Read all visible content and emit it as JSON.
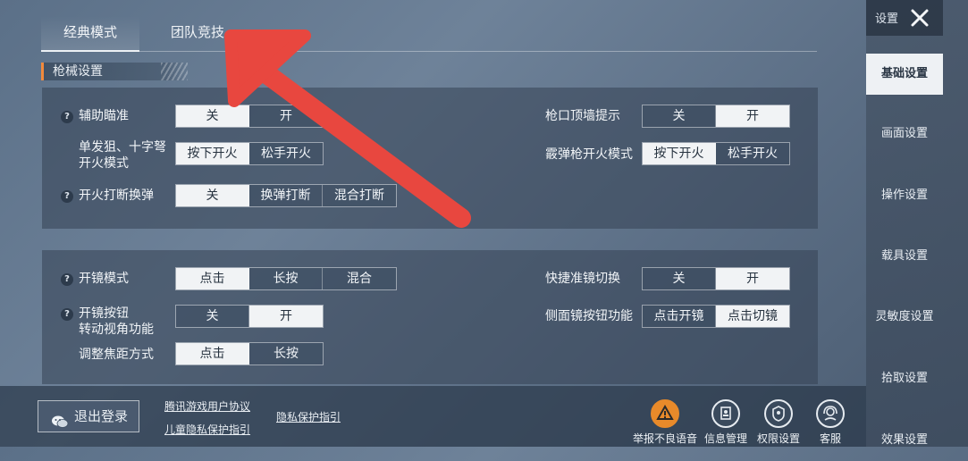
{
  "tabs": [
    "经典模式",
    "团队竞技"
  ],
  "section_title": "枪械设置",
  "panel1": {
    "aim_assist": {
      "label": "辅助瞄准",
      "options": [
        "关",
        "开"
      ]
    },
    "single_fire": {
      "label_line1": "单发狙、十字弩",
      "label_line2": "开火模式",
      "options": [
        "按下开火",
        "松手开火"
      ]
    },
    "fire_reload": {
      "label": "开火打断换弹",
      "options": [
        "关",
        "换弹打断",
        "混合打断"
      ]
    },
    "muzzle_wall": {
      "label": "枪口顶墙提示",
      "options": [
        "关",
        "开"
      ]
    },
    "shotgun_fire": {
      "label": "霰弹枪开火模式",
      "options": [
        "按下开火",
        "松手开火"
      ]
    }
  },
  "panel2": {
    "scope_mode": {
      "label": "开镜模式",
      "options": [
        "点击",
        "长按",
        "混合"
      ]
    },
    "scope_button": {
      "label_line1": "开镜按钮",
      "label_line2": "转动视角功能",
      "options": [
        "关",
        "开"
      ]
    },
    "zoom_adjust": {
      "label": "调整焦距方式",
      "options": [
        "点击",
        "长按"
      ]
    },
    "quick_scope_switch": {
      "label": "快捷准镜切换",
      "options": [
        "关",
        "开"
      ]
    },
    "side_scope_button": {
      "label": "侧面镜按钮功能",
      "options": [
        "点击开镜",
        "点击切镜"
      ]
    }
  },
  "sidebar": {
    "header": "设置",
    "items": [
      "基础设置",
      "画面设置",
      "操作设置",
      "载具设置",
      "灵敏度设置",
      "拾取设置",
      "效果设置"
    ]
  },
  "bottom": {
    "logout": "退出登录",
    "links": [
      "腾讯游戏用户协议",
      "儿童隐私保护指引",
      "隐私保护指引"
    ],
    "icons": [
      "举报不良语音",
      "信息管理",
      "权限设置",
      "客服"
    ]
  },
  "colors": {
    "accent": "#f28a3c",
    "arrow": "#e8473f",
    "selected_bg": "#f1f3f5"
  }
}
